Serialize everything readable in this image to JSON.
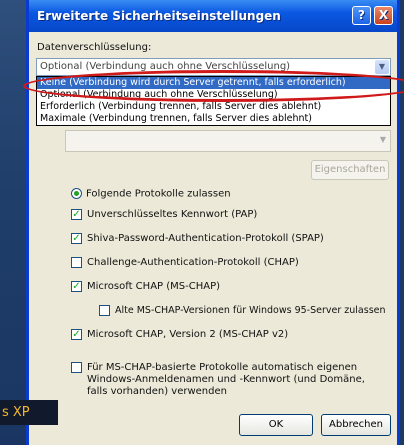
{
  "os_caption": "s XP",
  "dialog": {
    "title": "Erweiterte Sicherheitseinstellungen",
    "help_label": "?",
    "close_label": "X",
    "encryption_label": "Datenverschlüsselung:",
    "encryption_selected": "Optional (Verbindung auch ohne Verschlüsselung)",
    "encryption_options": [
      "Keine (Verbindung wird durch Server getrennt, falls erforderlich)",
      "Optional (Verbindung auch ohne Verschlüsselung)",
      "Erforderlich (Verbindung trennen, falls Server dies ablehnt)",
      "Maximale (Verbindung trennen, falls Server dies ablehnt)"
    ],
    "properties_button": "Eigenschaften",
    "protocols_radio": "Folgende Protokolle zulassen",
    "protocols": [
      {
        "label": "Unverschlüsseltes Kennwort (PAP)",
        "checked": true
      },
      {
        "label": "Shiva-Password-Authentication-Protokoll (SPAP)",
        "checked": true
      },
      {
        "label": "Challenge-Authentication-Protokoll (CHAP)",
        "checked": false
      },
      {
        "label": "Microsoft CHAP (MS-CHAP)",
        "checked": true
      },
      {
        "label": "Alte MS-CHAP-Versionen für Windows 95-Server zulassen",
        "checked": false
      },
      {
        "label": "Microsoft CHAP, Version 2 (MS-CHAP v2)",
        "checked": true
      }
    ],
    "auto_logon_label": "Für MS-CHAP-basierte Protokolle automatisch eigenen Windows-Anmeldenamen und -Kennwort (und Domäne, falls vorhanden) verwenden",
    "ok_button": "OK",
    "cancel_button": "Abbrechen"
  },
  "colors": {
    "titlebar": "#0a58e2",
    "window_bg": "#ece9d8",
    "highlight": "#316ac5",
    "annotation": "#d01919",
    "caption_text": "#f2b632"
  }
}
